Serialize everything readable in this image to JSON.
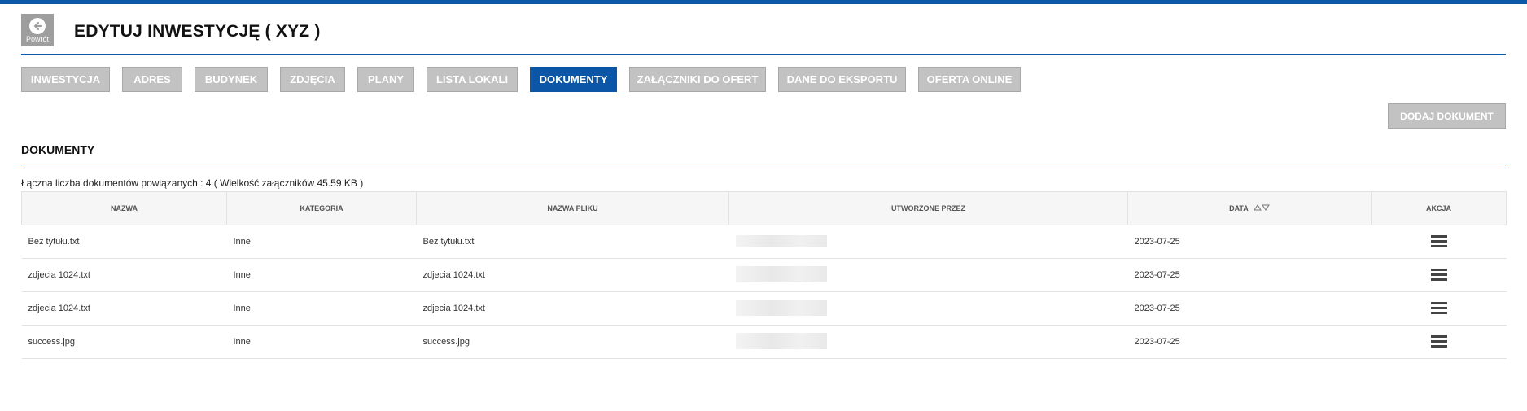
{
  "header": {
    "back_label": "Powrót",
    "title": "EDYTUJ INWESTYCJĘ ( XYZ )"
  },
  "tabs": [
    {
      "label": "INWESTYCJA",
      "active": false
    },
    {
      "label": "ADRES",
      "active": false
    },
    {
      "label": "BUDYNEK",
      "active": false
    },
    {
      "label": "ZDJĘCIA",
      "active": false
    },
    {
      "label": "PLANY",
      "active": false
    },
    {
      "label": "LISTA LOKALI",
      "active": false
    },
    {
      "label": "DOKUMENTY",
      "active": true
    },
    {
      "label": "ZAŁĄCZNIKI DO OFERT",
      "active": false
    },
    {
      "label": "DANE DO EKSPORTU",
      "active": false
    },
    {
      "label": "OFERTA ONLINE",
      "active": false
    }
  ],
  "add_document_label": "DODAJ DOKUMENT",
  "section_title": "DOKUMENTY",
  "summary": "Łączna liczba dokumentów powiązanych : 4 ( Wielkość załączników 45.59 KB )",
  "table": {
    "headers": [
      "NAZWA",
      "KATEGORIA",
      "NAZWA PLIKU",
      "UTWORZONE PRZEZ",
      "DATA",
      "AKCJA"
    ],
    "rows": [
      {
        "name": "Bez tytułu.txt",
        "category": "Inne",
        "file": "Bez tytułu.txt",
        "date": "2023-07-25"
      },
      {
        "name": "zdjecia 1024.txt",
        "category": "Inne",
        "file": "zdjecia 1024.txt",
        "date": "2023-07-25"
      },
      {
        "name": "zdjecia 1024.txt",
        "category": "Inne",
        "file": "zdjecia 1024.txt",
        "date": "2023-07-25"
      },
      {
        "name": "success.jpg",
        "category": "Inne",
        "file": "success.jpg",
        "date": "2023-07-25"
      }
    ]
  },
  "colors": {
    "accent": "#0b56a6",
    "tab_inactive": "#c2c2c2"
  },
  "icons": {
    "back": "arrow-left-circle-icon",
    "sort": "sort-arrows-icon",
    "row_action": "hamburger-menu-icon"
  }
}
